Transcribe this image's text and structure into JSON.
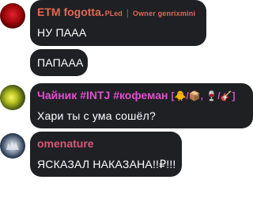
{
  "messages": [
    {
      "sender": "ETM fogotta.",
      "sender_tag": "PLed",
      "role": "Owner genrixmini",
      "texts": [
        "НУ ПААА",
        "ПАПАAA"
      ],
      "avatar_icon": "red-circle-avatar"
    },
    {
      "sender": "Чайник #INTJ #кофеман",
      "emoji_suffix": "[🐥/📦, 🍷/🎸]",
      "texts": [
        "Хари ты с ума сошёл?"
      ],
      "avatar_icon": "green-yellow-avatar"
    },
    {
      "sender": "omenature",
      "texts": [
        "ЯСКАЗАЛ НАКАЗАНА!!₽!!!"
      ],
      "avatar_icon": "mountain-avatar"
    }
  ],
  "colors": {
    "bubble": "#1f2023",
    "name_etm": "#e06a56",
    "name_chaynik": "#e24fcf",
    "name_omenature": "#d9577a"
  }
}
